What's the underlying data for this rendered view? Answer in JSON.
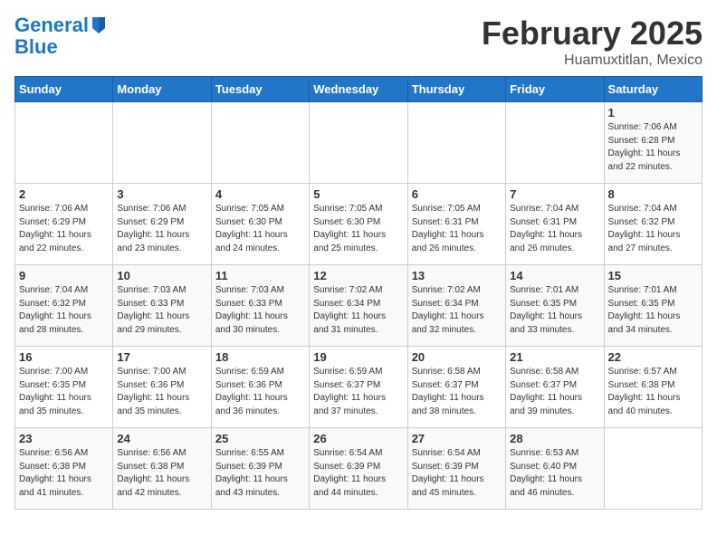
{
  "logo": {
    "line1": "General",
    "line2": "Blue"
  },
  "title": "February 2025",
  "subtitle": "Huamuxtitlan, Mexico",
  "days_of_week": [
    "Sunday",
    "Monday",
    "Tuesday",
    "Wednesday",
    "Thursday",
    "Friday",
    "Saturday"
  ],
  "weeks": [
    [
      {
        "num": "",
        "info": ""
      },
      {
        "num": "",
        "info": ""
      },
      {
        "num": "",
        "info": ""
      },
      {
        "num": "",
        "info": ""
      },
      {
        "num": "",
        "info": ""
      },
      {
        "num": "",
        "info": ""
      },
      {
        "num": "1",
        "info": "Sunrise: 7:06 AM\nSunset: 6:28 PM\nDaylight: 11 hours\nand 22 minutes."
      }
    ],
    [
      {
        "num": "2",
        "info": "Sunrise: 7:06 AM\nSunset: 6:29 PM\nDaylight: 11 hours\nand 22 minutes."
      },
      {
        "num": "3",
        "info": "Sunrise: 7:06 AM\nSunset: 6:29 PM\nDaylight: 11 hours\nand 23 minutes."
      },
      {
        "num": "4",
        "info": "Sunrise: 7:05 AM\nSunset: 6:30 PM\nDaylight: 11 hours\nand 24 minutes."
      },
      {
        "num": "5",
        "info": "Sunrise: 7:05 AM\nSunset: 6:30 PM\nDaylight: 11 hours\nand 25 minutes."
      },
      {
        "num": "6",
        "info": "Sunrise: 7:05 AM\nSunset: 6:31 PM\nDaylight: 11 hours\nand 26 minutes."
      },
      {
        "num": "7",
        "info": "Sunrise: 7:04 AM\nSunset: 6:31 PM\nDaylight: 11 hours\nand 26 minutes."
      },
      {
        "num": "8",
        "info": "Sunrise: 7:04 AM\nSunset: 6:32 PM\nDaylight: 11 hours\nand 27 minutes."
      }
    ],
    [
      {
        "num": "9",
        "info": "Sunrise: 7:04 AM\nSunset: 6:32 PM\nDaylight: 11 hours\nand 28 minutes."
      },
      {
        "num": "10",
        "info": "Sunrise: 7:03 AM\nSunset: 6:33 PM\nDaylight: 11 hours\nand 29 minutes."
      },
      {
        "num": "11",
        "info": "Sunrise: 7:03 AM\nSunset: 6:33 PM\nDaylight: 11 hours\nand 30 minutes."
      },
      {
        "num": "12",
        "info": "Sunrise: 7:02 AM\nSunset: 6:34 PM\nDaylight: 11 hours\nand 31 minutes."
      },
      {
        "num": "13",
        "info": "Sunrise: 7:02 AM\nSunset: 6:34 PM\nDaylight: 11 hours\nand 32 minutes."
      },
      {
        "num": "14",
        "info": "Sunrise: 7:01 AM\nSunset: 6:35 PM\nDaylight: 11 hours\nand 33 minutes."
      },
      {
        "num": "15",
        "info": "Sunrise: 7:01 AM\nSunset: 6:35 PM\nDaylight: 11 hours\nand 34 minutes."
      }
    ],
    [
      {
        "num": "16",
        "info": "Sunrise: 7:00 AM\nSunset: 6:35 PM\nDaylight: 11 hours\nand 35 minutes."
      },
      {
        "num": "17",
        "info": "Sunrise: 7:00 AM\nSunset: 6:36 PM\nDaylight: 11 hours\nand 35 minutes."
      },
      {
        "num": "18",
        "info": "Sunrise: 6:59 AM\nSunset: 6:36 PM\nDaylight: 11 hours\nand 36 minutes."
      },
      {
        "num": "19",
        "info": "Sunrise: 6:59 AM\nSunset: 6:37 PM\nDaylight: 11 hours\nand 37 minutes."
      },
      {
        "num": "20",
        "info": "Sunrise: 6:58 AM\nSunset: 6:37 PM\nDaylight: 11 hours\nand 38 minutes."
      },
      {
        "num": "21",
        "info": "Sunrise: 6:58 AM\nSunset: 6:37 PM\nDaylight: 11 hours\nand 39 minutes."
      },
      {
        "num": "22",
        "info": "Sunrise: 6:57 AM\nSunset: 6:38 PM\nDaylight: 11 hours\nand 40 minutes."
      }
    ],
    [
      {
        "num": "23",
        "info": "Sunrise: 6:56 AM\nSunset: 6:38 PM\nDaylight: 11 hours\nand 41 minutes."
      },
      {
        "num": "24",
        "info": "Sunrise: 6:56 AM\nSunset: 6:38 PM\nDaylight: 11 hours\nand 42 minutes."
      },
      {
        "num": "25",
        "info": "Sunrise: 6:55 AM\nSunset: 6:39 PM\nDaylight: 11 hours\nand 43 minutes."
      },
      {
        "num": "26",
        "info": "Sunrise: 6:54 AM\nSunset: 6:39 PM\nDaylight: 11 hours\nand 44 minutes."
      },
      {
        "num": "27",
        "info": "Sunrise: 6:54 AM\nSunset: 6:39 PM\nDaylight: 11 hours\nand 45 minutes."
      },
      {
        "num": "28",
        "info": "Sunrise: 6:53 AM\nSunset: 6:40 PM\nDaylight: 11 hours\nand 46 minutes."
      },
      {
        "num": "",
        "info": ""
      }
    ]
  ]
}
